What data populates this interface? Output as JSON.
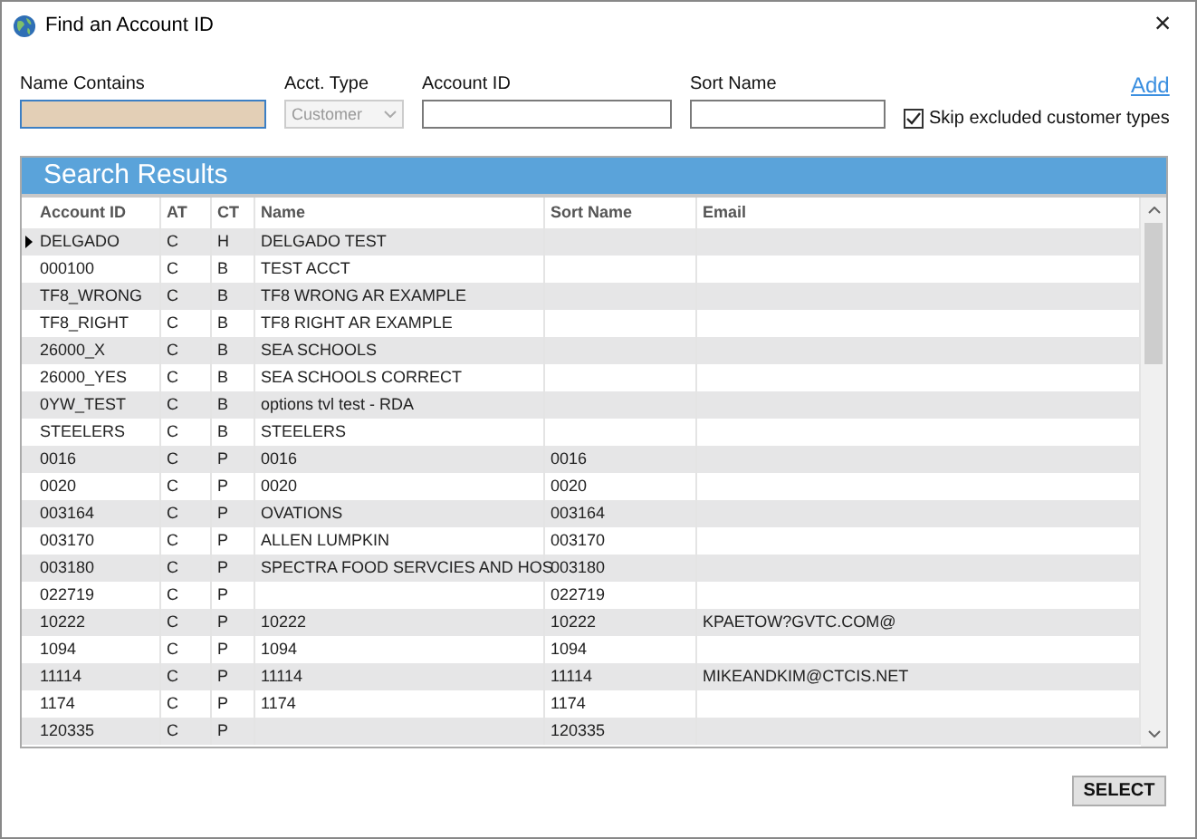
{
  "window": {
    "title": "Find an Account ID",
    "close": "×"
  },
  "filters": {
    "name_contains": {
      "label": "Name Contains",
      "focused": true
    },
    "acct_type": {
      "label": "Acct. Type",
      "value": "Customer",
      "disabled": true
    },
    "account_id": {
      "label": "Account ID"
    },
    "sort_name": {
      "label": "Sort Name"
    },
    "add_link": "Add",
    "skip_excluded": {
      "label": "Skip excluded customer types",
      "checked": true
    }
  },
  "results": {
    "title": "Search Results",
    "columns": [
      "Account ID",
      "AT",
      "CT",
      "Name",
      "Sort Name",
      "Email"
    ],
    "rows": [
      {
        "cells": [
          "DELGADO",
          "C",
          "H",
          "DELGADO TEST",
          "",
          ""
        ],
        "current": true
      },
      {
        "cells": [
          "000100",
          "C",
          "B",
          "TEST ACCT",
          "",
          ""
        ],
        "current": false
      },
      {
        "cells": [
          "TF8_WRONG",
          "C",
          "B",
          "TF8 WRONG AR EXAMPLE",
          "",
          ""
        ],
        "current": false
      },
      {
        "cells": [
          "TF8_RIGHT",
          "C",
          "B",
          "TF8 RIGHT AR EXAMPLE",
          "",
          ""
        ],
        "current": false
      },
      {
        "cells": [
          "26000_X",
          "C",
          "B",
          "SEA SCHOOLS",
          "",
          ""
        ],
        "current": false
      },
      {
        "cells": [
          "26000_YES",
          "C",
          "B",
          "SEA SCHOOLS CORRECT",
          "",
          ""
        ],
        "current": false
      },
      {
        "cells": [
          "0YW_TEST",
          "C",
          "B",
          "options tvl test - RDA",
          "",
          ""
        ],
        "current": false
      },
      {
        "cells": [
          "STEELERS",
          "C",
          "B",
          "STEELERS",
          "",
          ""
        ],
        "current": false
      },
      {
        "cells": [
          "0016",
          "C",
          "P",
          "0016",
          "0016",
          ""
        ],
        "current": false
      },
      {
        "cells": [
          "0020",
          "C",
          "P",
          "0020",
          "0020",
          ""
        ],
        "current": false
      },
      {
        "cells": [
          "003164",
          "C",
          "P",
          "OVATIONS",
          "003164",
          ""
        ],
        "current": false
      },
      {
        "cells": [
          "003170",
          "C",
          "P",
          "ALLEN LUMPKIN",
          "003170",
          ""
        ],
        "current": false
      },
      {
        "cells": [
          "003180",
          "C",
          "P",
          "SPECTRA FOOD SERVCIES AND HOS",
          "003180",
          ""
        ],
        "current": false
      },
      {
        "cells": [
          "022719",
          "C",
          "P",
          "",
          "022719",
          ""
        ],
        "current": false
      },
      {
        "cells": [
          "10222",
          "C",
          "P",
          "10222",
          "10222",
          "KPAETOW?GVTC.COM@"
        ],
        "current": false
      },
      {
        "cells": [
          "1094",
          "C",
          "P",
          "1094",
          "1094",
          ""
        ],
        "current": false
      },
      {
        "cells": [
          "11114",
          "C",
          "P",
          "11114",
          "11114",
          "MIKEANDKIM@CTCIS.NET"
        ],
        "current": false
      },
      {
        "cells": [
          "1174",
          "C",
          "P",
          "1174",
          "1174",
          ""
        ],
        "current": false
      },
      {
        "cells": [
          "120335",
          "C",
          "P",
          "",
          "120335",
          ""
        ],
        "current": false
      }
    ]
  },
  "select_button": "SELECT"
}
